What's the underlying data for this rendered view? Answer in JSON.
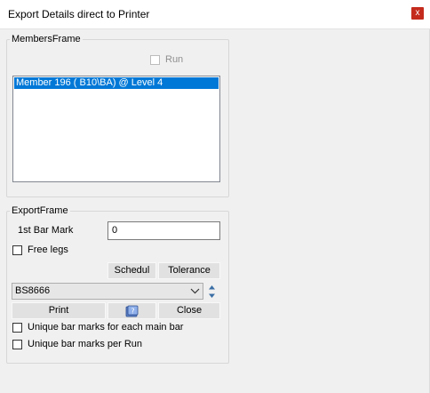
{
  "window": {
    "title": "Export Details direct to Printer",
    "close_glyph": "x",
    "close_color": "#c42b1c"
  },
  "members_frame": {
    "legend": "MembersFrame",
    "run_label": "Run",
    "run_checked": false,
    "run_enabled": false,
    "list_items": [
      "Member 196 ( B10\\BA) @ Level 4"
    ],
    "selected_index": 0,
    "selection_color": "#0078d7"
  },
  "export_frame": {
    "legend": "ExportFrame",
    "first_bar_mark_label": "1st Bar Mark",
    "first_bar_mark_value": "0",
    "free_legs_label": "Free legs",
    "free_legs_checked": false,
    "schedule_button": "Schedul",
    "tolerance_button": "Tolerance",
    "standard_value": "BS8666",
    "print_button": "Print",
    "help_icon": "help-book-icon",
    "close_button": "Close",
    "unique_each_main_bar_label": "Unique bar marks for each main bar",
    "unique_each_main_bar_checked": false,
    "unique_per_run_label": "Unique bar marks per Run",
    "unique_per_run_checked": false
  }
}
